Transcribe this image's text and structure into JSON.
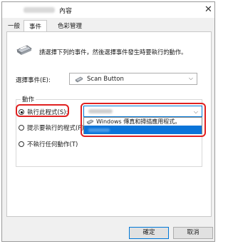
{
  "window": {
    "title": "內容",
    "close_glyph": "✕"
  },
  "tabs": [
    {
      "label": "一般",
      "active": false
    },
    {
      "label": "事件",
      "active": true
    },
    {
      "label": "色彩管理",
      "active": false
    }
  ],
  "instruction": "請選擇下列的事件，然後選擇事件發生時要執行的動作。",
  "event_select": {
    "label": "選擇事件(E):",
    "value": "Scan Button"
  },
  "actions": {
    "group_title": "動作",
    "options": [
      {
        "label": "執行此程式(S):",
        "checked": true
      },
      {
        "label": "提示要執行的程式(P)",
        "checked": false
      },
      {
        "label": "不執行任何動作(T)",
        "checked": false
      }
    ],
    "program_dropdown": {
      "items": [
        {
          "label": "Windows 傳真和掃描應用程式。"
        }
      ]
    }
  },
  "buttons": {
    "ok": "確定",
    "cancel": "取消"
  },
  "colors": {
    "highlight": "#e02020",
    "selection": "#0a74d9",
    "focus": "#0078d7"
  }
}
